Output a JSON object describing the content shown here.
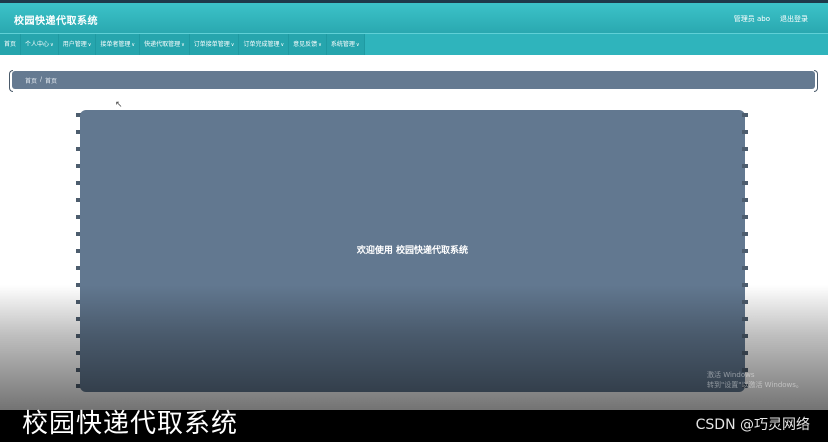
{
  "header": {
    "title": "校园快递代取系统",
    "admin_label": "管理员 abo",
    "logout_label": "退出登录"
  },
  "nav": {
    "items": [
      {
        "label": "首页",
        "has_menu": false
      },
      {
        "label": "个人中心",
        "has_menu": true
      },
      {
        "label": "用户管理",
        "has_menu": true
      },
      {
        "label": "接单者管理",
        "has_menu": true
      },
      {
        "label": "快递代取管理",
        "has_menu": true
      },
      {
        "label": "订单接单管理",
        "has_menu": true
      },
      {
        "label": "订单完成管理",
        "has_menu": true
      },
      {
        "label": "意见反馈",
        "has_menu": true
      },
      {
        "label": "系统管理",
        "has_menu": true
      }
    ],
    "caret": "∨"
  },
  "breadcrumb": {
    "home": "首页",
    "separator": "/",
    "current": "首页"
  },
  "main": {
    "welcome": "欢迎使用 校园快递代取系统"
  },
  "overlay": {
    "watermark_line1": "激活 Windows",
    "watermark_line2": "转到\"设置\"以激活 Windows。",
    "caption": "校园快递代取系统",
    "credit": "CSDN @巧灵网络"
  },
  "colors": {
    "header": "#2aa8b0",
    "nav": "#26a5ad",
    "panel": "#627890",
    "breadcrumb_bar": "#657a91"
  }
}
